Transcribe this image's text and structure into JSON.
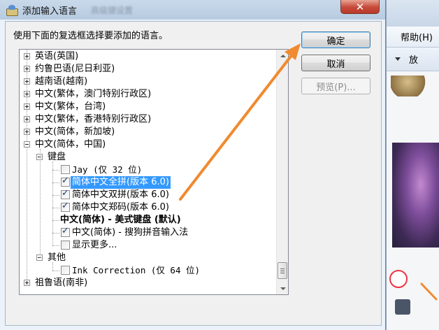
{
  "background_app": {
    "menu_item": "帮助(H)",
    "toolbar_item": "放"
  },
  "dialog": {
    "title": "添加输入语言",
    "title_ghost_text": "高级键设置",
    "close_glyph": "✕",
    "instruction": "使用下面的复选框选择要添加的语言。",
    "buttons": {
      "ok": "确定",
      "cancel": "取消",
      "preview": "预览(P)..."
    },
    "tree": {
      "languages": [
        {
          "label": "英语(英国)",
          "state": "collapsed"
        },
        {
          "label": "约鲁巴语(尼日利亚)",
          "state": "collapsed"
        },
        {
          "label": "越南语(越南)",
          "state": "collapsed"
        },
        {
          "label": "中文(繁体，澳门特别行政区)",
          "state": "collapsed"
        },
        {
          "label": "中文(繁体，台湾)",
          "state": "collapsed"
        },
        {
          "label": "中文(繁体，香港特别行政区)",
          "state": "collapsed"
        },
        {
          "label": "中文(简体，新加坡)",
          "state": "collapsed"
        },
        {
          "label": "中文(简体，中国)",
          "state": "expanded"
        }
      ],
      "keyboard_group": "键盘",
      "keyboard_items": [
        {
          "label": "Jay (仅 32 位)",
          "checked": false,
          "style": "mono"
        },
        {
          "label": "简体中文全拼(版本 6.0)",
          "checked": true,
          "style": "selected"
        },
        {
          "label": "简体中文双拼(版本 6.0)",
          "checked": true,
          "style": "normal"
        },
        {
          "label": "简体中文郑码(版本 6.0)",
          "checked": true,
          "style": "normal"
        },
        {
          "label": "中文(简体) - 美式键盘 (默认)",
          "checked": null,
          "style": "bold"
        },
        {
          "label": "中文(简体) - 搜狗拼音输入法",
          "checked": true,
          "style": "normal"
        },
        {
          "label": "显示更多...",
          "checked": false,
          "style": "normal"
        }
      ],
      "other_group": "其他",
      "other_items": [
        {
          "label": "Ink Correction (仅 64 位)",
          "checked": false,
          "style": "mono"
        }
      ],
      "last_language": {
        "label": "祖鲁语(南非)",
        "state": "collapsed"
      }
    }
  },
  "annotation": {
    "color": "#f08a30",
    "icon": "orange-arrow-pointing-to-ok-button"
  },
  "colors": {
    "selection": "#3399ff",
    "close_button": "#c6493a"
  }
}
